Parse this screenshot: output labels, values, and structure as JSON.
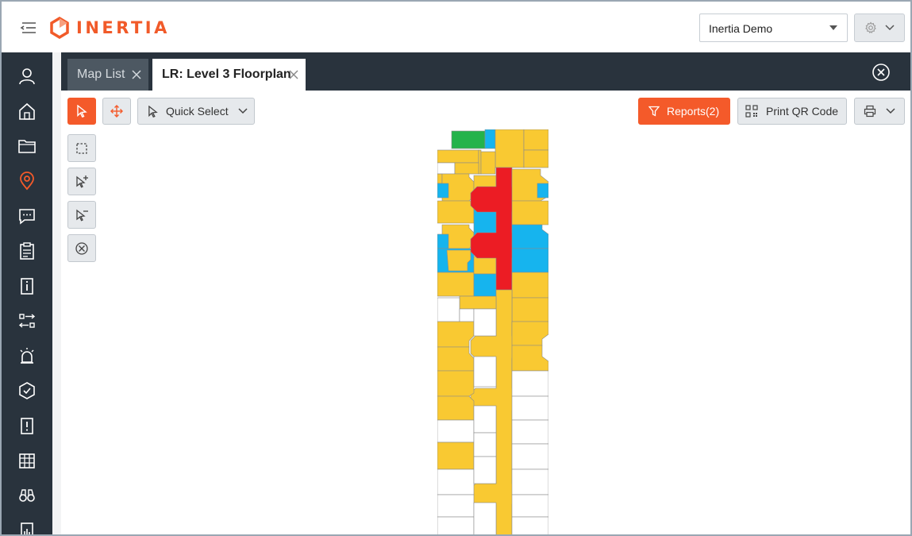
{
  "app": {
    "brand": "INERTIA",
    "brand_color": "#f15a29",
    "sidebar_color": "#29333d",
    "accent": "#f45a2a"
  },
  "header": {
    "collapse_icon": "collapse-menu-icon",
    "org_select": {
      "value": "Inertia Demo"
    },
    "settings_icon": "gear-icon"
  },
  "sidebar": {
    "items": [
      {
        "name": "user-icon",
        "active": false
      },
      {
        "name": "home-icon",
        "active": false
      },
      {
        "name": "folder-icon",
        "active": false
      },
      {
        "name": "map-pin-icon",
        "active": true
      },
      {
        "name": "chat-icon",
        "active": false
      },
      {
        "name": "clipboard-list-icon",
        "active": false
      },
      {
        "name": "info-document-icon",
        "active": false
      },
      {
        "name": "transfer-icon",
        "active": false
      },
      {
        "name": "alarm-icon",
        "active": false
      },
      {
        "name": "shield-check-icon",
        "active": false
      },
      {
        "name": "alert-document-icon",
        "active": false
      },
      {
        "name": "calendar-grid-icon",
        "active": false
      },
      {
        "name": "binoculars-icon",
        "active": false
      },
      {
        "name": "report-chart-icon",
        "active": false
      }
    ]
  },
  "tabs": [
    {
      "label": "Map List",
      "active": false
    },
    {
      "label": "LR: Level 3 Floorplan",
      "active": true
    }
  ],
  "toolbar": {
    "quick_select_label": "Quick Select",
    "reports_label": "Reports(2)",
    "print_qr_label": "Print QR Code"
  },
  "map_tools": [
    "marquee-select-icon",
    "add-select-icon",
    "remove-select-icon",
    "clear-selection-icon"
  ],
  "map_legend_colors": {
    "occupied": "#f9c932",
    "blue": "#16b4ee",
    "red": "#ec1c24",
    "green": "#24b34b",
    "vacant": "#ffffff"
  }
}
